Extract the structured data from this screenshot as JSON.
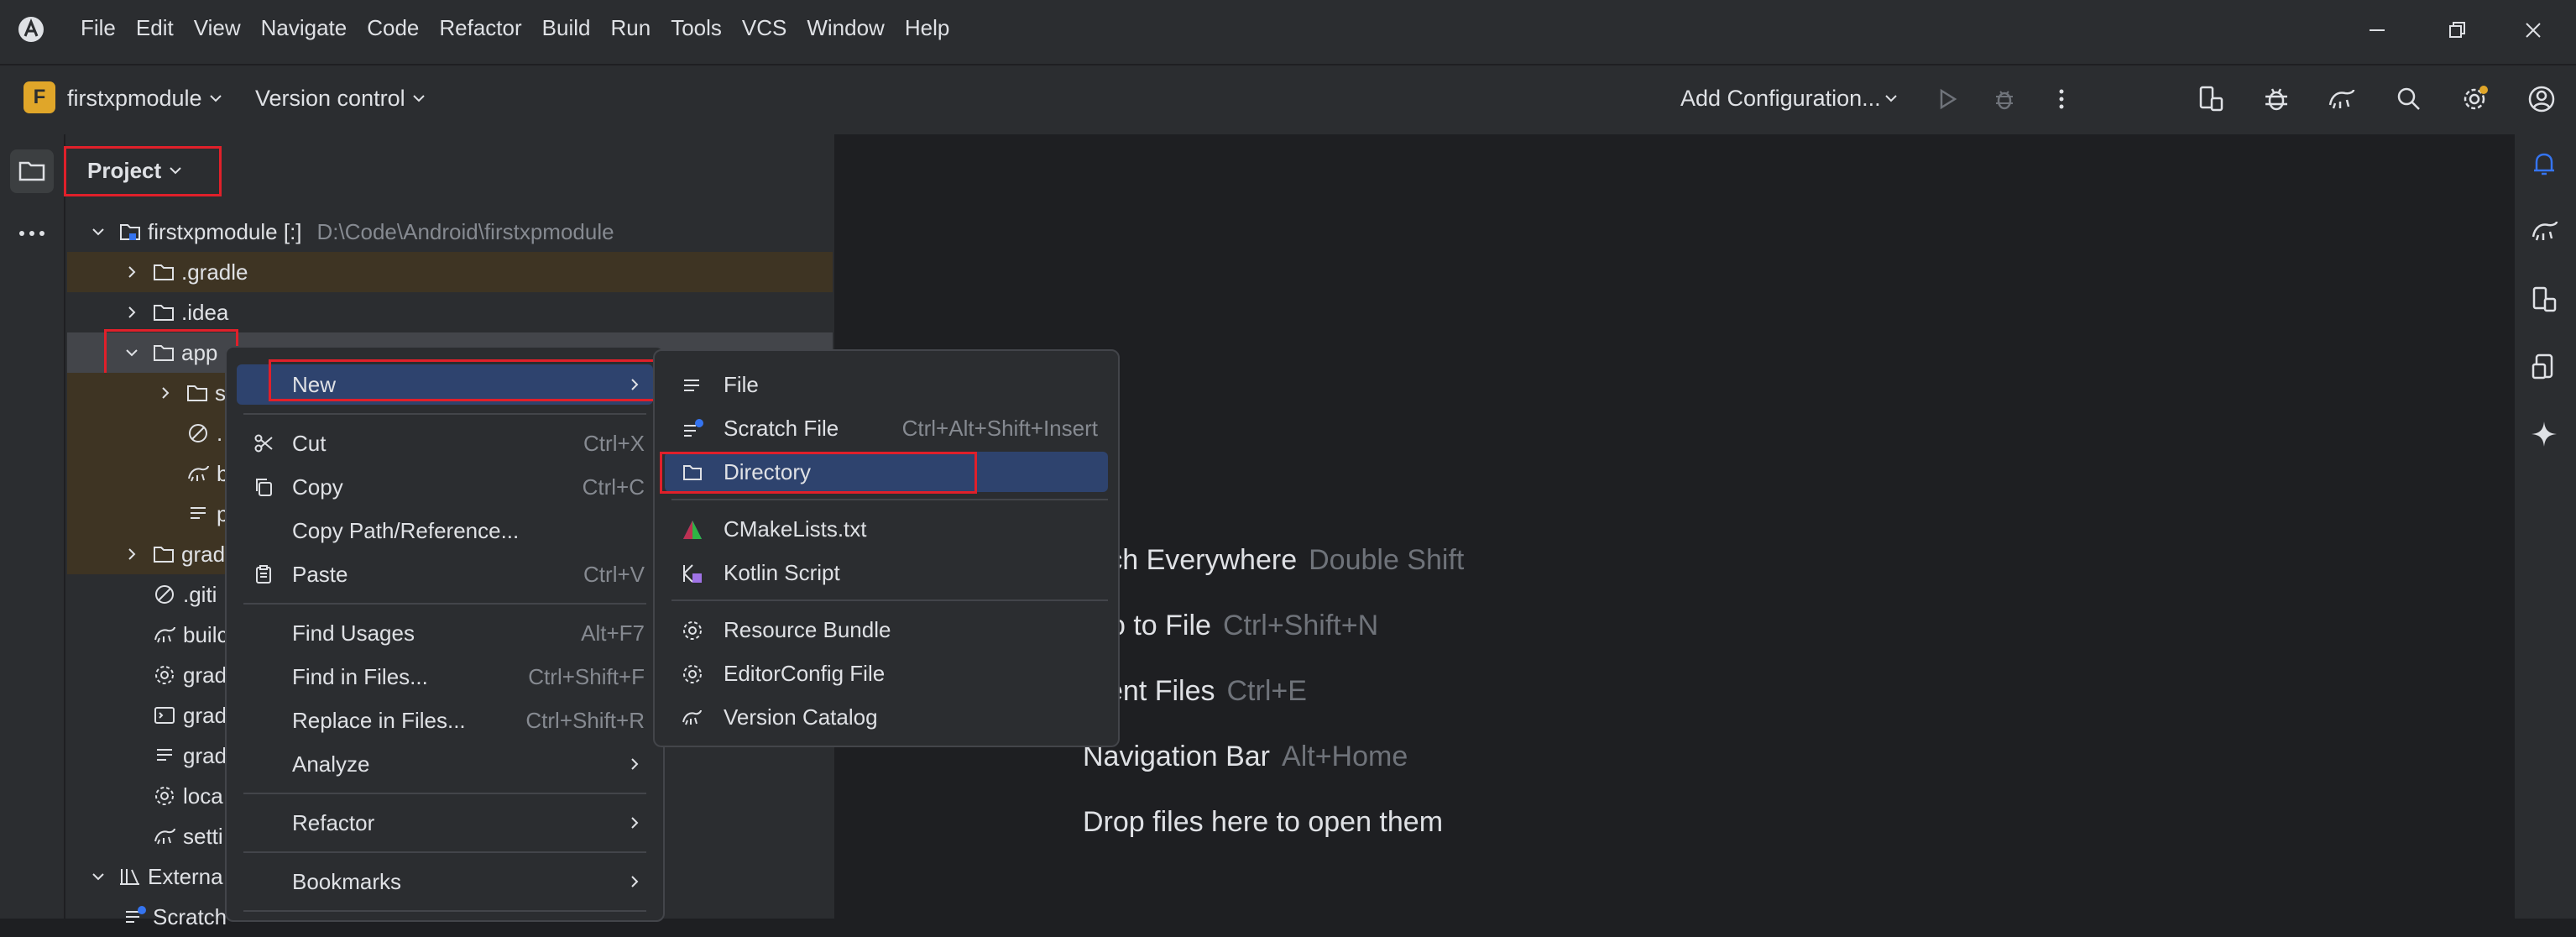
{
  "menubar": [
    "File",
    "Edit",
    "View",
    "Navigate",
    "Code",
    "Refactor",
    "Build",
    "Run",
    "Tools",
    "VCS",
    "Window",
    "Help"
  ],
  "toolbar": {
    "project_initial": "F",
    "project_name": "firstxpmodule",
    "vcs_label": "Version control",
    "run_config": "Add Configuration..."
  },
  "panel": {
    "title": "Project",
    "root_name": "firstxpmodule [:]",
    "root_path": "D:\\Code\\Android\\firstxpmodule",
    "tree": [
      {
        "label": ".gradle"
      },
      {
        "label": ".idea"
      },
      {
        "label": "app"
      },
      {
        "label": "s"
      },
      {
        "label": "."
      },
      {
        "label": "b"
      },
      {
        "label": "p"
      },
      {
        "label": "grad"
      },
      {
        "label": ".giti"
      },
      {
        "label": "builc"
      },
      {
        "label": "grad"
      },
      {
        "label": "grad"
      },
      {
        "label": "grad"
      },
      {
        "label": "loca"
      },
      {
        "label": "setti"
      },
      {
        "label": "Externa"
      },
      {
        "label": "Scratch"
      }
    ]
  },
  "context_menu": {
    "items": [
      {
        "label": "New",
        "key": ""
      },
      {
        "label": "Cut",
        "key": "Ctrl+X"
      },
      {
        "label": "Copy",
        "key": "Ctrl+C"
      },
      {
        "label": "Copy Path/Reference...",
        "key": ""
      },
      {
        "label": "Paste",
        "key": "Ctrl+V"
      },
      {
        "label": "Find Usages",
        "key": "Alt+F7"
      },
      {
        "label": "Find in Files...",
        "key": "Ctrl+Shift+F"
      },
      {
        "label": "Replace in Files...",
        "key": "Ctrl+Shift+R"
      },
      {
        "label": "Analyze",
        "key": ""
      },
      {
        "label": "Refactor",
        "key": ""
      },
      {
        "label": "Bookmarks",
        "key": ""
      }
    ]
  },
  "new_submenu": {
    "items": [
      {
        "label": "File",
        "key": ""
      },
      {
        "label": "Scratch File",
        "key": "Ctrl+Alt+Shift+Insert"
      },
      {
        "label": "Directory",
        "key": ""
      },
      {
        "label": "CMakeLists.txt",
        "key": ""
      },
      {
        "label": "Kotlin Script",
        "key": ""
      },
      {
        "label": "Resource Bundle",
        "key": ""
      },
      {
        "label": "EditorConfig File",
        "key": ""
      },
      {
        "label": "Version Catalog",
        "key": ""
      }
    ]
  },
  "editor_hints": [
    {
      "label": "arch Everywhere",
      "shortcut": "Double Shift"
    },
    {
      "label": "o to File",
      "shortcut": "Ctrl+Shift+N"
    },
    {
      "label": "cent Files",
      "shortcut": "Ctrl+E"
    },
    {
      "label": "Navigation Bar",
      "shortcut": "Alt+Home"
    },
    {
      "label": "Drop files here to open them",
      "shortcut": ""
    }
  ],
  "colors": {
    "highlight": "#e0202a",
    "selection": "#2e436e",
    "accent": "#3574f0"
  }
}
